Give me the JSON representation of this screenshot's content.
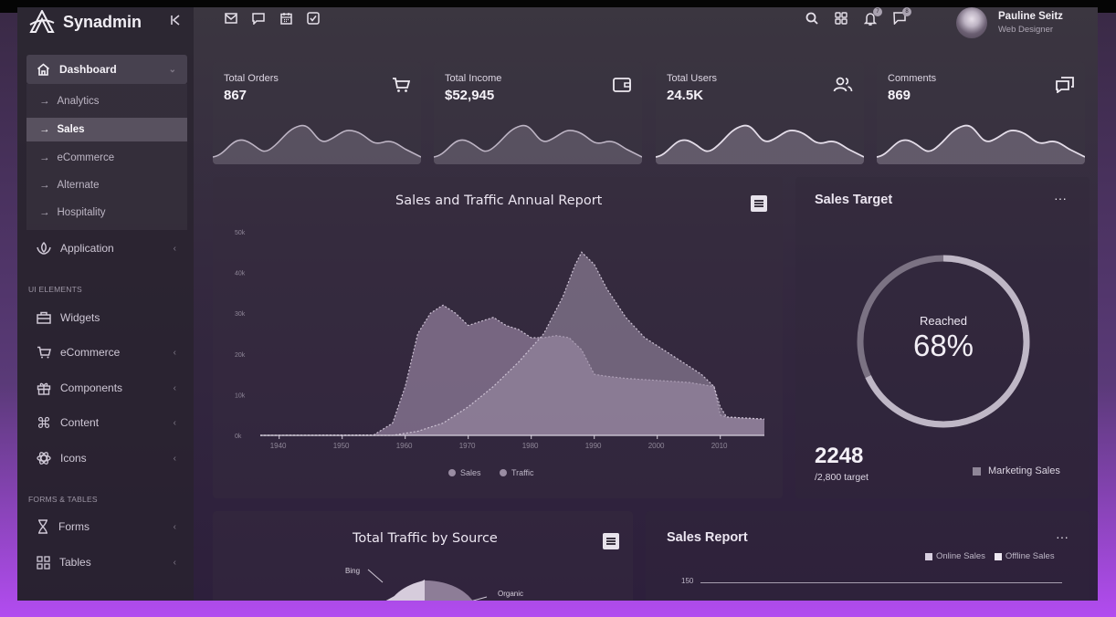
{
  "brand": {
    "name": "Synadmin",
    "collapse_icon": "collapse-icon"
  },
  "sidebar": {
    "dashboard": {
      "label": "Dashboard",
      "icon": "home-icon"
    },
    "sub_items": [
      {
        "label": "Analytics"
      },
      {
        "label": "Sales"
      },
      {
        "label": "eCommerce"
      },
      {
        "label": "Alternate"
      },
      {
        "label": "Hospitality"
      }
    ],
    "application": {
      "label": "Application",
      "icon": "app-icon"
    },
    "section_ui": "UI ELEMENTS",
    "ui_items": [
      {
        "label": "Widgets",
        "icon": "briefcase-icon"
      },
      {
        "label": "eCommerce",
        "icon": "cart-icon"
      },
      {
        "label": "Components",
        "icon": "gift-icon"
      },
      {
        "label": "Content",
        "icon": "command-icon"
      },
      {
        "label": "Icons",
        "icon": "atom-icon"
      }
    ],
    "section_forms": "FORMS & TABLES",
    "form_items": [
      {
        "label": "Forms",
        "icon": "hourglass-icon"
      },
      {
        "label": "Tables",
        "icon": "grid-icon"
      }
    ]
  },
  "header": {
    "left_icons": [
      "mail-icon",
      "chat-icon",
      "calendar-icon",
      "checkbox-icon"
    ],
    "right_icons": [
      "search-icon",
      "apps-icon",
      "bell-icon",
      "message-icon"
    ],
    "notifications_badge": "7",
    "messages_badge": "8",
    "user": {
      "name": "Pauline Seitz",
      "role": "Web Designer"
    }
  },
  "stats": [
    {
      "label": "Total Orders",
      "value": "867",
      "icon": "cart-icon"
    },
    {
      "label": "Total Income",
      "value": "$52,945",
      "icon": "wallet-icon"
    },
    {
      "label": "Total Users",
      "value": "24.5K",
      "icon": "users-icon"
    },
    {
      "label": "Comments",
      "value": "869",
      "icon": "comments-icon"
    }
  ],
  "annual_report": {
    "title": "Sales and Traffic Annual Report",
    "legend": [
      "Sales",
      "Traffic"
    ],
    "y_ticks": [
      "50k",
      "40k",
      "30k",
      "20k",
      "10k",
      "0k"
    ],
    "x_ticks": [
      "1940",
      "1950",
      "1960",
      "1970",
      "1980",
      "1990",
      "2000",
      "2010"
    ]
  },
  "sales_target": {
    "title": "Sales Target",
    "reached_label": "Reached",
    "percent": "68%",
    "percent_value": 68,
    "count": "2248",
    "target": "/2,800 target",
    "legend": "Marketing Sales"
  },
  "traffic_source": {
    "title": "Total Traffic by Source",
    "labels": [
      "Bing",
      "Organic"
    ]
  },
  "sales_report": {
    "title": "Sales Report",
    "legend": [
      "Online Sales",
      "Offline Sales"
    ],
    "y_tick": "150"
  },
  "colors": {
    "sales_area": "#8e7b98",
    "traffic_area": "#a99aae",
    "accent": "#b24cf0"
  },
  "chart_data": {
    "type": "area",
    "title": "Sales and Traffic Annual Report",
    "xlabel": "",
    "ylabel": "",
    "xlim": [
      1937,
      2017
    ],
    "ylim": [
      0,
      50000
    ],
    "grid": false,
    "legend": "bottom",
    "series": [
      {
        "name": "Sales",
        "points": [
          [
            1937,
            0
          ],
          [
            1955,
            100
          ],
          [
            1958,
            3000
          ],
          [
            1960,
            12000
          ],
          [
            1962,
            25000
          ],
          [
            1964,
            30000
          ],
          [
            1966,
            32000
          ],
          [
            1968,
            30000
          ],
          [
            1970,
            27000
          ],
          [
            1972,
            28000
          ],
          [
            1974,
            29000
          ],
          [
            1976,
            27000
          ],
          [
            1978,
            26000
          ],
          [
            1980,
            24000
          ],
          [
            1982,
            24000
          ],
          [
            1984,
            24500
          ],
          [
            1986,
            24000
          ],
          [
            1988,
            21000
          ],
          [
            1990,
            15000
          ],
          [
            1992,
            14500
          ],
          [
            1995,
            14000
          ],
          [
            2000,
            13500
          ],
          [
            2005,
            13000
          ],
          [
            2009,
            12000
          ],
          [
            2010,
            5000
          ],
          [
            2011,
            4500
          ],
          [
            2017,
            4000
          ]
        ]
      },
      {
        "name": "Traffic",
        "points": [
          [
            1937,
            0
          ],
          [
            1958,
            0
          ],
          [
            1962,
            1000
          ],
          [
            1966,
            3000
          ],
          [
            1970,
            7000
          ],
          [
            1974,
            12000
          ],
          [
            1978,
            18000
          ],
          [
            1982,
            25000
          ],
          [
            1985,
            34000
          ],
          [
            1987,
            42000
          ],
          [
            1988,
            45000
          ],
          [
            1990,
            42000
          ],
          [
            1992,
            36000
          ],
          [
            1995,
            29000
          ],
          [
            1998,
            24000
          ],
          [
            2001,
            21000
          ],
          [
            2004,
            18000
          ],
          [
            2007,
            15000
          ],
          [
            2009,
            12000
          ],
          [
            2010,
            7000
          ],
          [
            2011,
            4500
          ],
          [
            2017,
            4000
          ]
        ]
      }
    ]
  }
}
